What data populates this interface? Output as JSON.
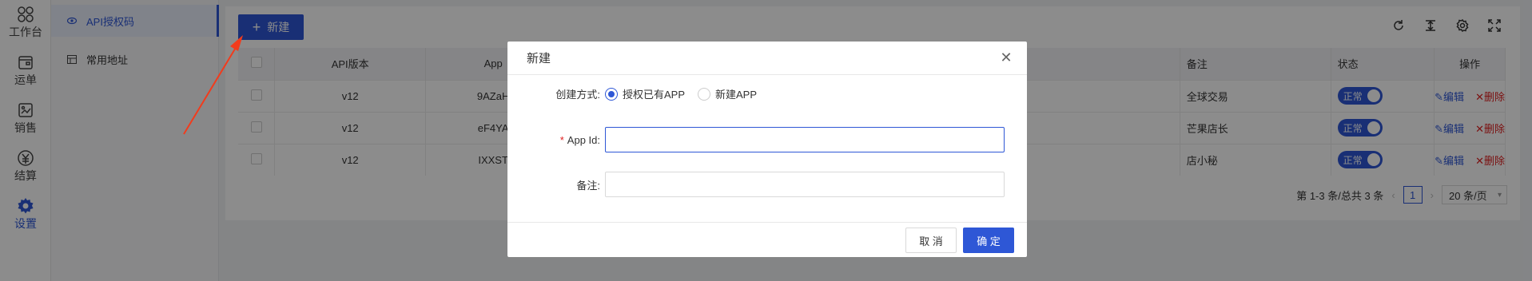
{
  "rail": [
    {
      "label": "工作台",
      "icon": "workbench-icon"
    },
    {
      "label": "运单",
      "icon": "waybill-icon"
    },
    {
      "label": "销售",
      "icon": "sales-icon"
    },
    {
      "label": "结算",
      "icon": "settlement-icon"
    },
    {
      "label": "设置",
      "icon": "gear-icon",
      "active": true
    }
  ],
  "submenu": [
    {
      "label": "API授权码",
      "icon": "eye-icon",
      "active": true
    },
    {
      "label": "常用地址",
      "icon": "address-icon"
    }
  ],
  "toolbar": {
    "new_label": "新建"
  },
  "table": {
    "headers": [
      "API版本",
      "App",
      "备注",
      "状态",
      "操作"
    ],
    "rows": [
      {
        "version": "v12",
        "app": "9AZaH",
        "remark": "全球交易",
        "status": "正常"
      },
      {
        "version": "v12",
        "app": "eF4YA",
        "remark": "芒果店长",
        "status": "正常"
      },
      {
        "version": "v12",
        "app": "IXXST",
        "remark": "店小秘",
        "status": "正常"
      }
    ],
    "edit_label": "✎编辑",
    "delete_label": "✕删除"
  },
  "pager": {
    "summary": "第 1-3 条/总共 3 条",
    "current": "1",
    "prev": "‹",
    "next": "›",
    "page_size": "20 条/页"
  },
  "modal": {
    "title": "新建",
    "create_mode_label": "创建方式:",
    "option_existing": "授权已有APP",
    "option_new": "新建APP",
    "app_id_label": "App Id:",
    "remark_label": "备注:",
    "app_id_value": "",
    "remark_value": "",
    "cancel_label": "取 消",
    "ok_label": "确 定"
  },
  "colors": {
    "primary": "#2e57d6",
    "danger": "#e02020",
    "arrow": "#f23b1c"
  }
}
